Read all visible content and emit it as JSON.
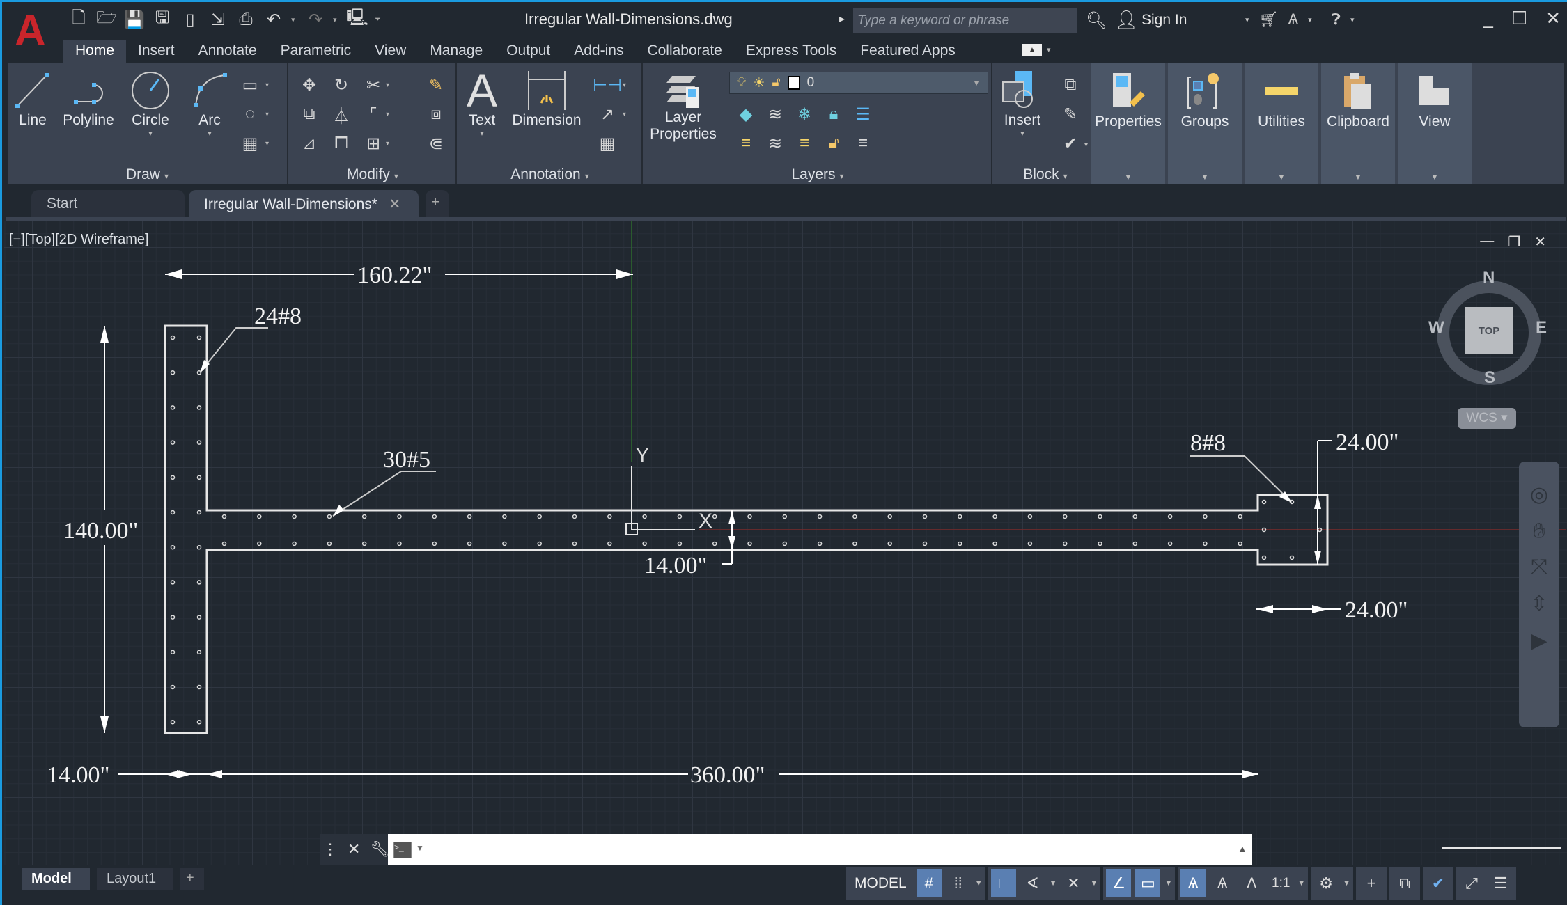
{
  "app": {
    "logo": "A",
    "title": "Irregular Wall-Dimensions.dwg",
    "search_placeholder": "Type a keyword or phrase",
    "sign_in": "Sign In",
    "window_controls": [
      "minimize-icon",
      "maximize-icon",
      "close-icon"
    ]
  },
  "quick_access": [
    "new-icon",
    "open-icon",
    "save-icon",
    "save-as-icon",
    "open-from-web-icon",
    "save-to-web-icon",
    "plot-icon",
    "undo-icon",
    "redo-icon",
    "workspace-icon",
    "customize-icon"
  ],
  "ribbon_tabs": [
    "Home",
    "Insert",
    "Annotate",
    "Parametric",
    "View",
    "Manage",
    "Output",
    "Add-ins",
    "Collaborate",
    "Express Tools",
    "Featured Apps"
  ],
  "ribbon_active_tab": "Home",
  "ribbon": {
    "draw": {
      "title": "Draw",
      "buttons": [
        "Line",
        "Polyline",
        "Circle",
        "Arc"
      ]
    },
    "modify": {
      "title": "Modify"
    },
    "annotation": {
      "title": "Annotation",
      "buttons": [
        "Text",
        "Dimension"
      ]
    },
    "layers": {
      "title": "Layers",
      "properties_label_1": "Layer",
      "properties_label_2": "Properties",
      "current_layer": "0"
    },
    "block": {
      "title": "Block",
      "insert": "Insert"
    },
    "slideouts": [
      "Properties",
      "Groups",
      "Utilities",
      "Clipboard",
      "View"
    ]
  },
  "doc_tabs": {
    "start": "Start",
    "active": "Irregular Wall-Dimensions*",
    "close": "✕",
    "add": "+"
  },
  "viewport": {
    "label": "[−][Top][2D Wireframe]",
    "viewcube": {
      "face": "TOP",
      "n": "N",
      "s": "S",
      "e": "E",
      "w": "W",
      "wcs": "WCS"
    },
    "ucs": {
      "x": "X",
      "y": "Y"
    }
  },
  "drawing": {
    "dimensions": {
      "top": "160.22\"",
      "left_height": "140.00\"",
      "web_thickness": "14.00\"",
      "bottom_left": "14.00\"",
      "bottom_total": "360.00\"",
      "end_height": "24.00\"",
      "end_width": "24.00\""
    },
    "leaders": {
      "left_wall_bars": "24#8",
      "web_bars": "30#5",
      "end_bars": "8#8"
    }
  },
  "layout_tabs": {
    "model": "Model",
    "layout1": "Layout1",
    "add": "+"
  },
  "status": {
    "model": "MODEL",
    "scale": "1:1"
  }
}
